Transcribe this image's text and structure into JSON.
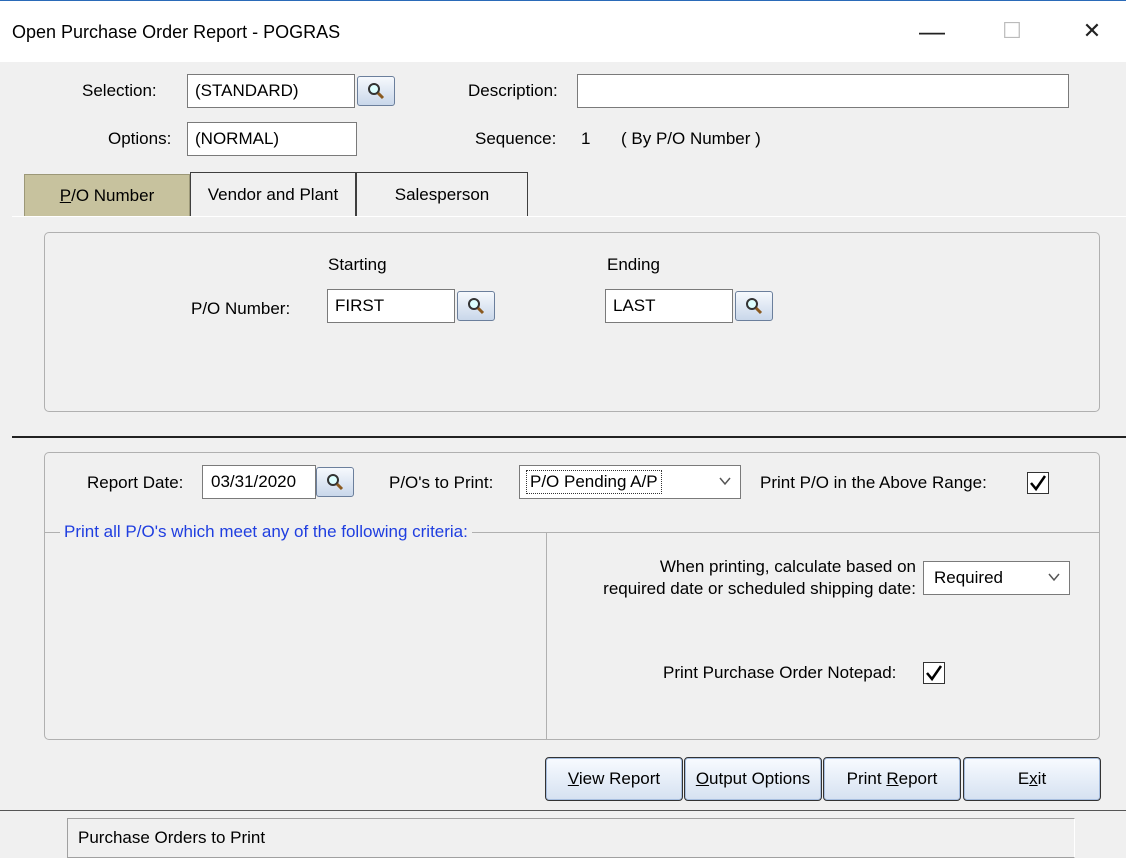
{
  "window": {
    "title": "Open Purchase Order Report - POGRAS",
    "minimize": "—",
    "maximize": "☐",
    "close": "✕"
  },
  "header": {
    "selection_label": "Selection:",
    "selection_value": "(STANDARD)",
    "description_label": "Description:",
    "description_value": "",
    "options_label": "Options:",
    "options_value": "(NORMAL)",
    "sequence_label": "Sequence:",
    "sequence_value": "1",
    "sequence_desc": "( By P/O Number )"
  },
  "tabs": [
    {
      "pre": "",
      "u": "P",
      "post": "/O Number",
      "active": true
    },
    {
      "label": "Vendor and Plant",
      "active": false
    },
    {
      "label": "Salesperson",
      "active": false
    }
  ],
  "range": {
    "starting_label": "Starting",
    "ending_label": "Ending",
    "po_label": "P/O Number:",
    "start_value": "FIRST",
    "end_value": "LAST"
  },
  "report": {
    "date_label": "Report Date:",
    "date_value": "03/31/2020",
    "to_print_label": "P/O's  to Print:",
    "to_print_value": "P/O Pending A/P",
    "print_range_label": "Print P/O in the Above Range:",
    "print_range_checked": true,
    "criteria_label": "Print all P/O's which meet any of the following criteria:",
    "calc_label_1": "When printing, calculate based on",
    "calc_label_2": "required date or scheduled shipping date:",
    "calc_value": "Required",
    "notepad_label": "Print Purchase Order Notepad:",
    "notepad_checked": true
  },
  "buttons": {
    "view": {
      "u": "V",
      "rest": "iew Report"
    },
    "output": {
      "u": "O",
      "rest": "utput Options"
    },
    "print": {
      "pre": "Print ",
      "u": "R",
      "rest": "eport"
    },
    "exit": {
      "pre": "E",
      "u": "x",
      "rest": "it"
    }
  },
  "status_text": "Purchase Orders to Print",
  "colors": {
    "accent_tab": "#c7c29e",
    "criteria_text": "#1f3ee0",
    "title_border": "#2a6ab8"
  },
  "icons": [
    "magnifier-icon",
    "checkmark-icon",
    "dropdown-arrow-icon"
  ]
}
